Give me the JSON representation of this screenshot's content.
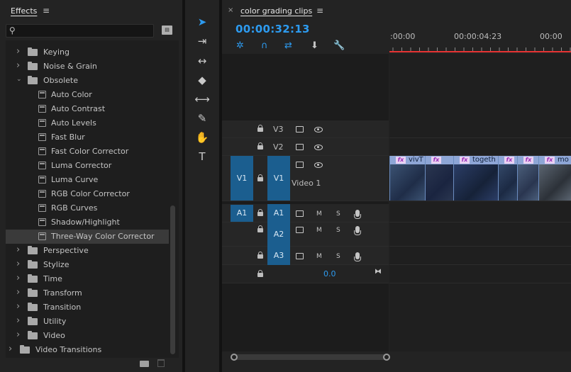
{
  "effects_panel": {
    "title": "Effects",
    "menu_glyph": "≡",
    "search": {
      "value": "",
      "placeholder": ""
    },
    "newbin_label": "▤",
    "tree": [
      {
        "label": "Keying",
        "type": "folder",
        "expanded": false
      },
      {
        "label": "Noise & Grain",
        "type": "folder",
        "expanded": false
      },
      {
        "label": "Obsolete",
        "type": "folder",
        "expanded": true
      },
      {
        "label": "Auto Color",
        "type": "effect"
      },
      {
        "label": "Auto Contrast",
        "type": "effect"
      },
      {
        "label": "Auto Levels",
        "type": "effect"
      },
      {
        "label": "Fast Blur",
        "type": "effect"
      },
      {
        "label": "Fast Color Corrector",
        "type": "effect"
      },
      {
        "label": "Luma Corrector",
        "type": "effect"
      },
      {
        "label": "Luma Curve",
        "type": "effect"
      },
      {
        "label": "RGB Color Corrector",
        "type": "effect"
      },
      {
        "label": "RGB Curves",
        "type": "effect"
      },
      {
        "label": "Shadow/Highlight",
        "type": "effect"
      },
      {
        "label": "Three-Way Color Corrector",
        "type": "effect",
        "selected": true
      },
      {
        "label": "Perspective",
        "type": "folder",
        "expanded": false
      },
      {
        "label": "Stylize",
        "type": "folder",
        "expanded": false
      },
      {
        "label": "Time",
        "type": "folder",
        "expanded": false
      },
      {
        "label": "Transform",
        "type": "folder",
        "expanded": false
      },
      {
        "label": "Transition",
        "type": "folder",
        "expanded": false
      },
      {
        "label": "Utility",
        "type": "folder",
        "expanded": false
      },
      {
        "label": "Video",
        "type": "folder",
        "expanded": false
      },
      {
        "label": "Video Transitions",
        "type": "top-folder",
        "expanded": false
      }
    ]
  },
  "tools": [
    {
      "name": "selection-tool",
      "glyph": "➤",
      "active": true
    },
    {
      "name": "track-select-tool",
      "glyph": "⇥"
    },
    {
      "name": "ripple-edit-tool",
      "glyph": "↔"
    },
    {
      "name": "razor-tool",
      "glyph": "◆"
    },
    {
      "name": "slip-tool",
      "glyph": "⟷"
    },
    {
      "name": "pen-tool",
      "glyph": "✎"
    },
    {
      "name": "hand-tool",
      "glyph": "✋"
    },
    {
      "name": "type-tool",
      "glyph": "T"
    }
  ],
  "timeline": {
    "close_glyph": "×",
    "title": "color grading clips",
    "menu_glyph": "≡",
    "timecode": "00:00:32:13",
    "tool_icons": [
      "nest-icon",
      "snap-icon",
      "linked-selection-icon",
      "add-marker-icon",
      "settings-wrench-icon"
    ],
    "tool_glyphs": [
      "✲",
      "∩",
      "⇄",
      "⬇",
      "🔧"
    ],
    "ruler_labels": [
      ":00:00",
      "00:00:04:23",
      "00:00"
    ],
    "video_tracks": [
      {
        "name": "V3",
        "source": "",
        "label": ""
      },
      {
        "name": "V2",
        "source": "",
        "label": ""
      },
      {
        "name": "V1",
        "source": "V1",
        "label": "Video 1"
      }
    ],
    "audio_tracks": [
      {
        "name": "A1",
        "source": "A1"
      },
      {
        "name": "A2",
        "source": ""
      },
      {
        "name": "A3",
        "source": ""
      }
    ],
    "audio_controls": {
      "mute": "M",
      "solo": "S"
    },
    "master_value": "0.0",
    "clips": [
      {
        "name": "vivT"
      },
      {
        "name": ""
      },
      {
        "name": "togeth"
      },
      {
        "name": ""
      },
      {
        "name": ""
      },
      {
        "name": "mo"
      }
    ],
    "fx_label": "fx",
    "colors": {
      "accent": "#2d9bf0",
      "playhead": "#e63333",
      "track_target": "#1b5e8f"
    }
  }
}
